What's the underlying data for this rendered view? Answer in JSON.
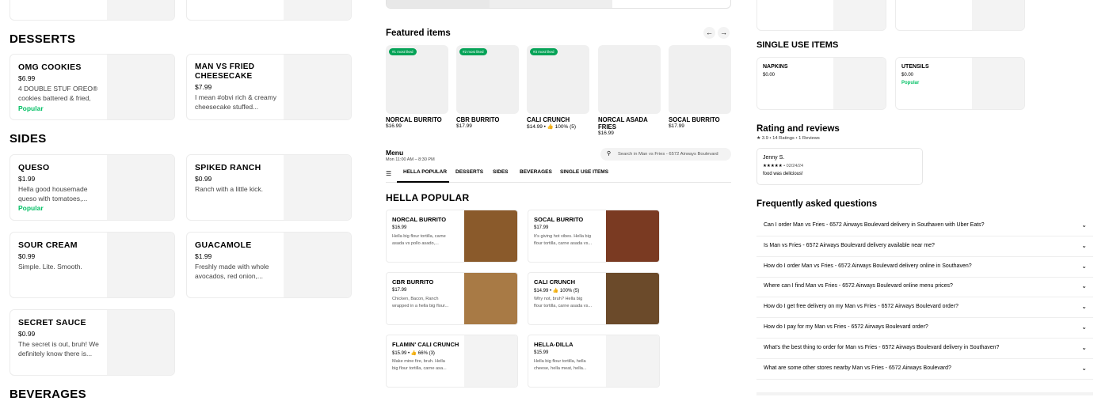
{
  "left": {
    "desserts_title": "DESSERTS",
    "sides_title": "SIDES",
    "beverages_title": "BEVERAGES",
    "omg": {
      "name": "OMG COOKIES",
      "price": "$6.99",
      "desc1": "4 DOUBLE STUF OREO®",
      "desc2": "cookies battered & fried,",
      "desc3": "...",
      "badge": "Popular"
    },
    "cheesecake": {
      "name1": "MAN VS FRIED",
      "name2": "CHEESECAKE",
      "price": "$7.99",
      "desc1": "I mean #obvi rich & creamy",
      "desc2": "cheesecake stuffed..."
    },
    "queso": {
      "name": "QUESO",
      "price": "$1.99",
      "desc1": "Hella good housemade",
      "desc2": "queso with tomatoes,...",
      "badge": "Popular"
    },
    "ranch": {
      "name": "SPIKED RANCH",
      "price": "$0.99",
      "desc": "Ranch with a little kick."
    },
    "sour": {
      "name": "SOUR CREAM",
      "price": "$0.99",
      "desc": "Simple. Lite. Smooth."
    },
    "guac": {
      "name": "GUACAMOLE",
      "price": "$1.99",
      "desc1": "Freshly made with whole",
      "desc2": "avocados, red onion,..."
    },
    "sauce": {
      "name": "SECRET SAUCE",
      "price": "$0.99",
      "desc1": "The secret is out, bruh! We",
      "desc2": "definitely know there is..."
    }
  },
  "featured": {
    "title": "Featured items",
    "prev_arrow": "←",
    "next_arrow": "→",
    "items": [
      {
        "badge": "#1 most liked",
        "name": "NORCAL BURRITO",
        "price": "$16.99"
      },
      {
        "badge": "#2 most liked",
        "name": "CBR BURRITO",
        "price": "$17.99"
      },
      {
        "badge": "#3 most liked",
        "name": "CALI CRUNCH",
        "price": "$14.99 • 👍 100% (5)"
      },
      {
        "badge": "",
        "name": "NORCAL ASADA FRIES",
        "price": "$16.99"
      },
      {
        "badge": "",
        "name": "SOCAL BURRITO",
        "price": "$17.99"
      }
    ]
  },
  "menu": {
    "title": "Menu",
    "hours": "Mon 11:00 AM – 8:30 PM",
    "search_placeholder": "Search in Man vs Fries - 6572 Airways Boulevard",
    "tabs": [
      "HELLA POPULAR",
      "DESSERTS",
      "SIDES",
      "BEVERAGES",
      "SINGLE USE ITEMS"
    ],
    "section_title": "HELLA POPULAR",
    "items": [
      {
        "name": "NORCAL BURRITO",
        "price": "$16.99",
        "desc1": "Hella big flour tortilla, carne",
        "desc2": "asada vs pollo asado,...",
        "img_color": "#8a5a2b"
      },
      {
        "name": "SOCAL BURRITO",
        "price": "$17.99",
        "desc1": "It's giving hot vibes. Hella big",
        "desc2": "flour tortilla, carne asada vs...",
        "img_color": "#7a3a22"
      },
      {
        "name": "CBR BURRITO",
        "price": "$17.99",
        "desc1": "Chicken, Bacon, Ranch",
        "desc2": "wrapped in a hella big flour...",
        "img_color": "#a87a45"
      },
      {
        "name": "CALI CRUNCH",
        "price": "$14.99 • 👍 100% (5)",
        "desc1": "Why not, bruh? Hella big",
        "desc2": "flour tortilla, carne asada vs...",
        "img_color": "#6b4a2a"
      },
      {
        "name": "FLAMIN' CALI CRUNCH",
        "price": "$15.99 • 👍 66% (3)",
        "desc1": "Make mine fire, bruh. Hella",
        "desc2": "big flour tortilla, carne asa...",
        "img_color": "#f3f3f3"
      },
      {
        "name": "HELLA-DILLA",
        "price": "$15.99",
        "desc1": "Hella big flour tortilla, hella",
        "desc2": "cheese, hella meat, hella...",
        "img_color": "#f3f3f3"
      }
    ]
  },
  "right": {
    "single_use_title": "SINGLE USE ITEMS",
    "napkins": {
      "name": "NAPKINS",
      "price": "$0.00"
    },
    "utensils": {
      "name": "UTENSILS",
      "price": "$0.00",
      "badge": "Popular"
    },
    "rating_title": "Rating and reviews",
    "rating_summary": "★ 3.9 • 14 Ratings • 1 Reviews",
    "review": {
      "author": "Jenny S.",
      "stars": "★★★★★",
      "date": " • 02/24/24",
      "text": "food was delicious!"
    },
    "faq_title": "Frequently asked questions",
    "faqs": [
      "Can I order Man vs Fries - 6572 Airways Boulevard delivery in Southaven with Uber Eats?",
      "Is Man vs Fries - 6572 Airways Boulevard delivery available near me?",
      "How do I order Man vs Fries - 6572 Airways Boulevard delivery online in Southaven?",
      "Where can I find Man vs Fries - 6572 Airways Boulevard online menu prices?",
      "How do I get free delivery on my Man vs Fries - 6572 Airways Boulevard order?",
      "How do I pay for my Man vs Fries - 6572 Airways Boulevard order?",
      "What's the best thing to order for Man vs Fries - 6572 Airways Boulevard delivery in Southaven?",
      "What are some other stores nearby Man vs Fries - 6572 Airways Boulevard?"
    ],
    "chevron": "⌄"
  }
}
